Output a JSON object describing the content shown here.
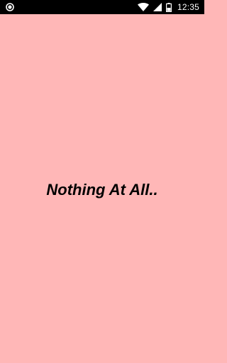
{
  "status_bar": {
    "time": "12:35",
    "icons": [
      "notification-dot-icon",
      "wifi-icon",
      "signal-icon",
      "battery-icon"
    ]
  },
  "main": {
    "message": "Nothing At All.."
  },
  "colors": {
    "background": "#ffb7b7",
    "status_bar": "#000000",
    "text": "#000000"
  }
}
